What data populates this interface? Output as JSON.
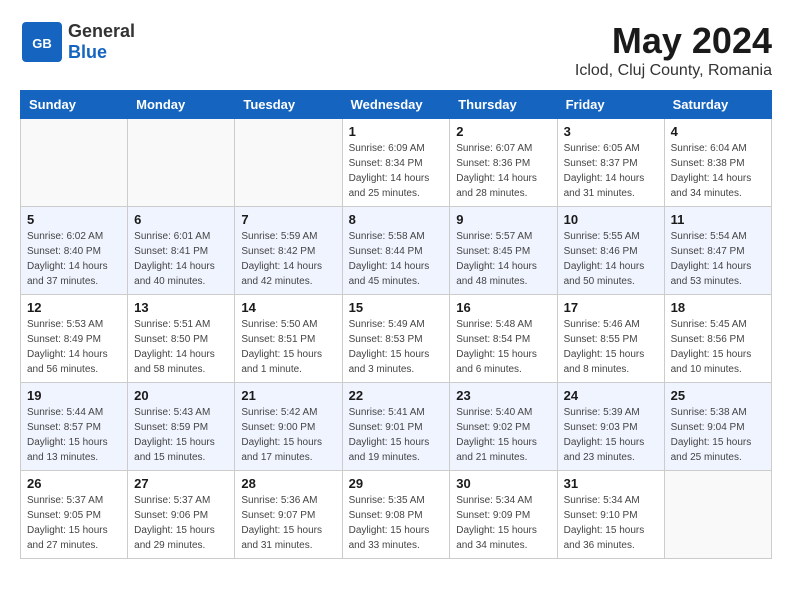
{
  "header": {
    "logo_general": "General",
    "logo_blue": "Blue",
    "month_year": "May 2024",
    "location": "Iclod, Cluj County, Romania"
  },
  "weekdays": [
    "Sunday",
    "Monday",
    "Tuesday",
    "Wednesday",
    "Thursday",
    "Friday",
    "Saturday"
  ],
  "weeks": [
    [
      {
        "day": "",
        "info": ""
      },
      {
        "day": "",
        "info": ""
      },
      {
        "day": "",
        "info": ""
      },
      {
        "day": "1",
        "info": "Sunrise: 6:09 AM\nSunset: 8:34 PM\nDaylight: 14 hours\nand 25 minutes."
      },
      {
        "day": "2",
        "info": "Sunrise: 6:07 AM\nSunset: 8:36 PM\nDaylight: 14 hours\nand 28 minutes."
      },
      {
        "day": "3",
        "info": "Sunrise: 6:05 AM\nSunset: 8:37 PM\nDaylight: 14 hours\nand 31 minutes."
      },
      {
        "day": "4",
        "info": "Sunrise: 6:04 AM\nSunset: 8:38 PM\nDaylight: 14 hours\nand 34 minutes."
      }
    ],
    [
      {
        "day": "5",
        "info": "Sunrise: 6:02 AM\nSunset: 8:40 PM\nDaylight: 14 hours\nand 37 minutes."
      },
      {
        "day": "6",
        "info": "Sunrise: 6:01 AM\nSunset: 8:41 PM\nDaylight: 14 hours\nand 40 minutes."
      },
      {
        "day": "7",
        "info": "Sunrise: 5:59 AM\nSunset: 8:42 PM\nDaylight: 14 hours\nand 42 minutes."
      },
      {
        "day": "8",
        "info": "Sunrise: 5:58 AM\nSunset: 8:44 PM\nDaylight: 14 hours\nand 45 minutes."
      },
      {
        "day": "9",
        "info": "Sunrise: 5:57 AM\nSunset: 8:45 PM\nDaylight: 14 hours\nand 48 minutes."
      },
      {
        "day": "10",
        "info": "Sunrise: 5:55 AM\nSunset: 8:46 PM\nDaylight: 14 hours\nand 50 minutes."
      },
      {
        "day": "11",
        "info": "Sunrise: 5:54 AM\nSunset: 8:47 PM\nDaylight: 14 hours\nand 53 minutes."
      }
    ],
    [
      {
        "day": "12",
        "info": "Sunrise: 5:53 AM\nSunset: 8:49 PM\nDaylight: 14 hours\nand 56 minutes."
      },
      {
        "day": "13",
        "info": "Sunrise: 5:51 AM\nSunset: 8:50 PM\nDaylight: 14 hours\nand 58 minutes."
      },
      {
        "day": "14",
        "info": "Sunrise: 5:50 AM\nSunset: 8:51 PM\nDaylight: 15 hours\nand 1 minute."
      },
      {
        "day": "15",
        "info": "Sunrise: 5:49 AM\nSunset: 8:53 PM\nDaylight: 15 hours\nand 3 minutes."
      },
      {
        "day": "16",
        "info": "Sunrise: 5:48 AM\nSunset: 8:54 PM\nDaylight: 15 hours\nand 6 minutes."
      },
      {
        "day": "17",
        "info": "Sunrise: 5:46 AM\nSunset: 8:55 PM\nDaylight: 15 hours\nand 8 minutes."
      },
      {
        "day": "18",
        "info": "Sunrise: 5:45 AM\nSunset: 8:56 PM\nDaylight: 15 hours\nand 10 minutes."
      }
    ],
    [
      {
        "day": "19",
        "info": "Sunrise: 5:44 AM\nSunset: 8:57 PM\nDaylight: 15 hours\nand 13 minutes."
      },
      {
        "day": "20",
        "info": "Sunrise: 5:43 AM\nSunset: 8:59 PM\nDaylight: 15 hours\nand 15 minutes."
      },
      {
        "day": "21",
        "info": "Sunrise: 5:42 AM\nSunset: 9:00 PM\nDaylight: 15 hours\nand 17 minutes."
      },
      {
        "day": "22",
        "info": "Sunrise: 5:41 AM\nSunset: 9:01 PM\nDaylight: 15 hours\nand 19 minutes."
      },
      {
        "day": "23",
        "info": "Sunrise: 5:40 AM\nSunset: 9:02 PM\nDaylight: 15 hours\nand 21 minutes."
      },
      {
        "day": "24",
        "info": "Sunrise: 5:39 AM\nSunset: 9:03 PM\nDaylight: 15 hours\nand 23 minutes."
      },
      {
        "day": "25",
        "info": "Sunrise: 5:38 AM\nSunset: 9:04 PM\nDaylight: 15 hours\nand 25 minutes."
      }
    ],
    [
      {
        "day": "26",
        "info": "Sunrise: 5:37 AM\nSunset: 9:05 PM\nDaylight: 15 hours\nand 27 minutes."
      },
      {
        "day": "27",
        "info": "Sunrise: 5:37 AM\nSunset: 9:06 PM\nDaylight: 15 hours\nand 29 minutes."
      },
      {
        "day": "28",
        "info": "Sunrise: 5:36 AM\nSunset: 9:07 PM\nDaylight: 15 hours\nand 31 minutes."
      },
      {
        "day": "29",
        "info": "Sunrise: 5:35 AM\nSunset: 9:08 PM\nDaylight: 15 hours\nand 33 minutes."
      },
      {
        "day": "30",
        "info": "Sunrise: 5:34 AM\nSunset: 9:09 PM\nDaylight: 15 hours\nand 34 minutes."
      },
      {
        "day": "31",
        "info": "Sunrise: 5:34 AM\nSunset: 9:10 PM\nDaylight: 15 hours\nand 36 minutes."
      },
      {
        "day": "",
        "info": ""
      }
    ]
  ]
}
